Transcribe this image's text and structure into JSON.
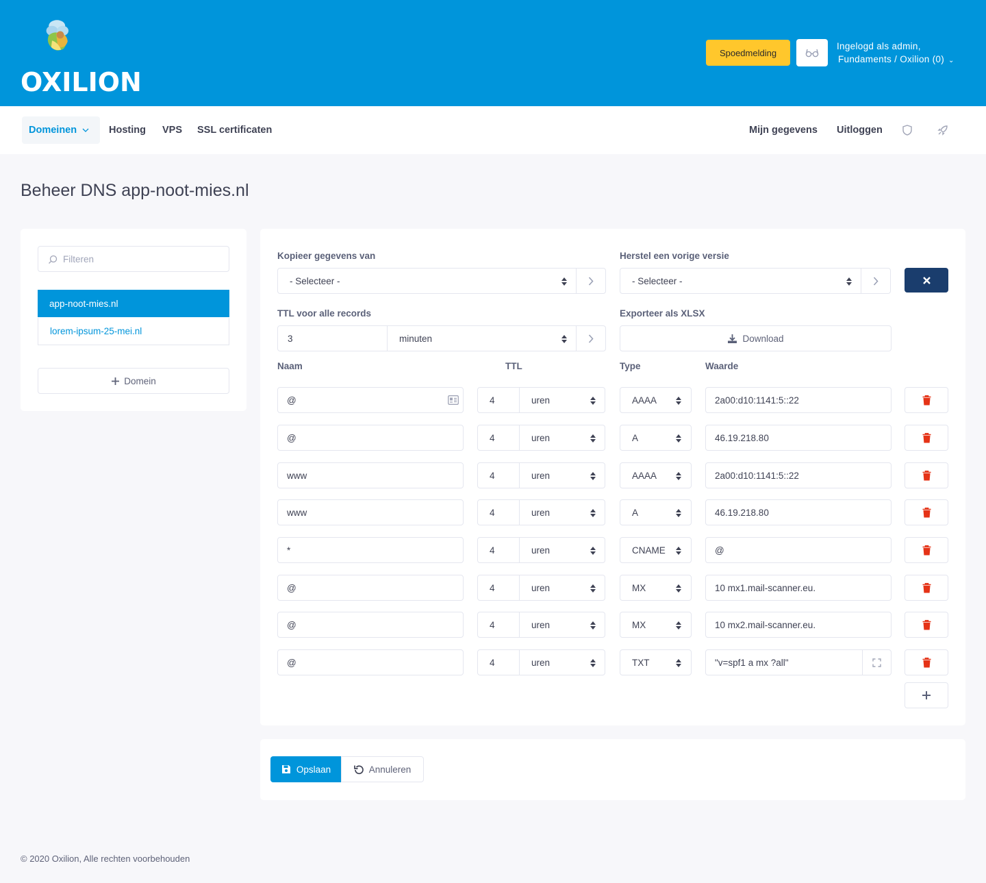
{
  "brand": {
    "name": "OXILION"
  },
  "header": {
    "urgent_label": "Spoedmelding",
    "user_line1": "Ingelogd als admin,",
    "user_line2": "Fundaments / Oxilion (0)"
  },
  "nav": {
    "items": [
      {
        "label": "Domeinen"
      },
      {
        "label": "Hosting"
      },
      {
        "label": "VPS"
      },
      {
        "label": "SSL certificaten"
      }
    ],
    "right": [
      {
        "label": "Mijn gegevens"
      },
      {
        "label": "Uitloggen"
      }
    ]
  },
  "page": {
    "title": "Beheer DNS app-noot-mies.nl"
  },
  "sidebar": {
    "filter_placeholder": "Filteren",
    "domains": [
      {
        "label": "app-noot-mies.nl",
        "active": true
      },
      {
        "label": "lorem-ipsum-25-mei.nl",
        "active": false
      }
    ],
    "add_domain_label": "Domein"
  },
  "tools": {
    "copy_label": "Kopieer gegevens van",
    "copy_value": "- Selecteer -",
    "restore_label": "Herstel een vorige versie",
    "restore_value": "- Selecteer -",
    "ttl_all_label": "TTL voor alle records",
    "ttl_all_value": "3",
    "ttl_all_unit": "minuten",
    "export_label": "Exporteer als XLSX",
    "download_label": "Download"
  },
  "table": {
    "headers": {
      "name": "Naam",
      "ttl": "TTL",
      "type": "Type",
      "value": "Waarde"
    },
    "records": [
      {
        "name": "@",
        "ttl": "4",
        "unit": "uren",
        "type": "AAAA",
        "value": "2a00:d10:1141:5::22"
      },
      {
        "name": "@",
        "ttl": "4",
        "unit": "uren",
        "type": "A",
        "value": "46.19.218.80"
      },
      {
        "name": "www",
        "ttl": "4",
        "unit": "uren",
        "type": "AAAA",
        "value": "2a00:d10:1141:5::22"
      },
      {
        "name": "www",
        "ttl": "4",
        "unit": "uren",
        "type": "A",
        "value": "46.19.218.80"
      },
      {
        "name": "*",
        "ttl": "4",
        "unit": "uren",
        "type": "CNAME",
        "value": "@"
      },
      {
        "name": "@",
        "ttl": "4",
        "unit": "uren",
        "type": "MX",
        "value": "10 mx1.mail-scanner.eu."
      },
      {
        "name": "@",
        "ttl": "4",
        "unit": "uren",
        "type": "MX",
        "value": "10 mx2.mail-scanner.eu."
      },
      {
        "name": "@",
        "ttl": "4",
        "unit": "uren",
        "type": "TXT",
        "value": "\"v=spf1 a mx ?all\""
      }
    ]
  },
  "actions": {
    "save_label": "Opslaan",
    "cancel_label": "Annuleren"
  },
  "footer": {
    "text": "© 2020 Oxilion, Alle rechten voorbehouden"
  },
  "colors": {
    "primary": "#0095db",
    "warning": "#ffc72c",
    "danger": "#e53317",
    "navy": "#1a3d6d"
  }
}
